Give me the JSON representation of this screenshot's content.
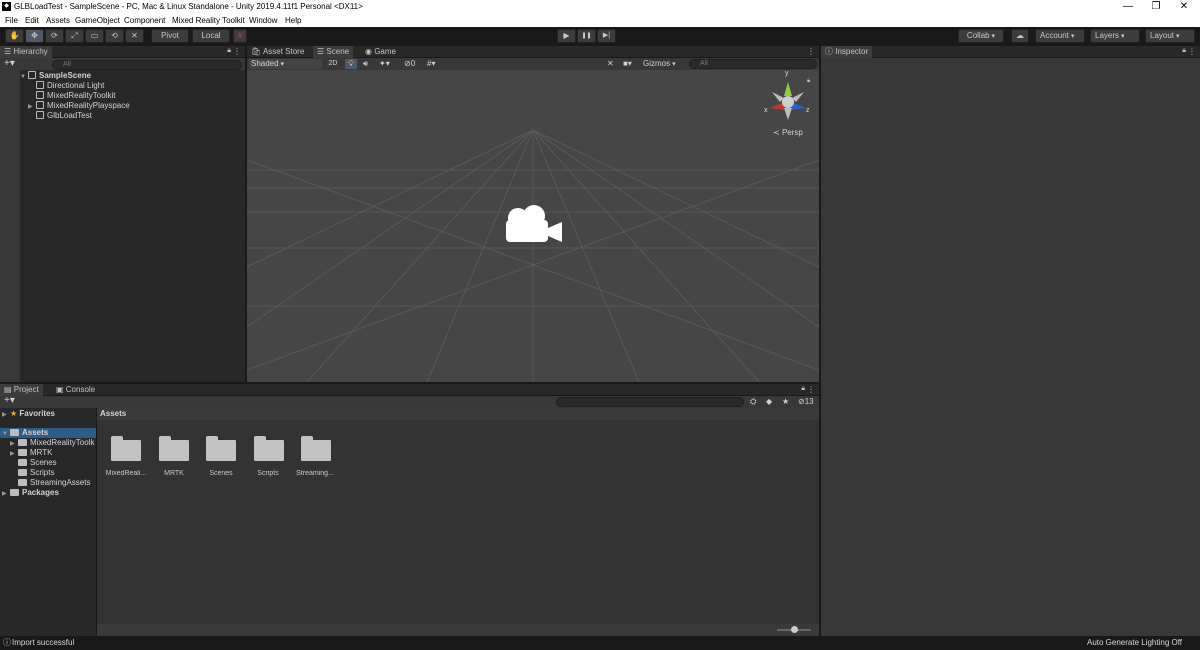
{
  "window": {
    "title": "GLBLoadTest - SampleScene - PC, Mac & Linux Standalone - Unity 2019.4.11f1 Personal <DX11>",
    "app_icon": "unity-logo-icon",
    "controls": {
      "minimize": "—",
      "restore": "❐",
      "close": "✕"
    }
  },
  "menu": [
    "File",
    "Edit",
    "Assets",
    "GameObject",
    "Component",
    "Mixed Reality Toolkit",
    "Window",
    "Help"
  ],
  "toolbar": {
    "tools": [
      "✋",
      "✥",
      "⟳",
      "⤢",
      "▭",
      "⟲",
      "✕"
    ],
    "pivot_label": "Pivot",
    "local_label": "Local",
    "grid_snap": "#",
    "play": "▶",
    "pause": "❚❚",
    "step": "▶|",
    "collab_label": "Collab",
    "cloud": "☁",
    "account_label": "Account",
    "layers_label": "Layers",
    "layout_label": "Layout"
  },
  "hierarchy": {
    "tab": "Hierarchy",
    "add": "+▾",
    "search_placeholder": "All",
    "scene": "SampleScene",
    "items": [
      "Directional Light",
      "MixedRealityToolkit",
      "MixedRealityPlayspace",
      "GlbLoadTest"
    ]
  },
  "scene_view": {
    "tabs": [
      "Asset Store",
      "Scene",
      "Game"
    ],
    "shading": "Shaded",
    "mode_2d": "2D",
    "hidden_count": "0",
    "gizmos_label": "Gizmos",
    "search_placeholder": "All",
    "persp_label": "Persp",
    "axis_labels": {
      "x": "x",
      "y": "y",
      "z": "z"
    }
  },
  "inspector": {
    "tab": "Inspector"
  },
  "project": {
    "tabs": [
      "Project",
      "Console"
    ],
    "add": "+▾",
    "filter_count": "13",
    "favorites": "Favorites",
    "assets": "Assets",
    "tree": [
      "MixedRealityToolk",
      "MRTK",
      "Scenes",
      "Scripts",
      "StreamingAssets"
    ],
    "packages": "Packages",
    "breadcrumb": "Assets",
    "folders": [
      "MixedReali...",
      "MRTK",
      "Scenes",
      "Scripts",
      "Streaming..."
    ]
  },
  "status": {
    "message": "Import successful",
    "lighting": "Auto Generate Lighting Off"
  },
  "colors": {
    "accent": "#3a72b0",
    "panel": "#383838",
    "dark": "#191919",
    "grid": "#5a5a5a"
  }
}
